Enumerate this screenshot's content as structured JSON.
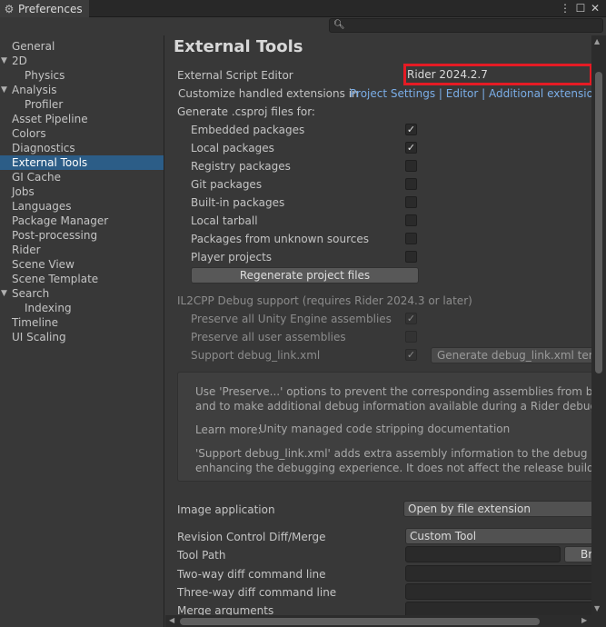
{
  "window": {
    "tab_title": "Preferences",
    "menu_icon": "kebab-menu-icon",
    "maximize_icon": "maximize-icon",
    "close_icon": "close-icon"
  },
  "sidebar": {
    "items": [
      {
        "label": "General"
      },
      {
        "label": "2D",
        "expanded": true
      },
      {
        "label": "Physics"
      },
      {
        "label": "Analysis",
        "expanded": true
      },
      {
        "label": "Profiler"
      },
      {
        "label": "Asset Pipeline"
      },
      {
        "label": "Colors"
      },
      {
        "label": "Diagnostics"
      },
      {
        "label": "External Tools",
        "selected": true
      },
      {
        "label": "GI Cache"
      },
      {
        "label": "Jobs"
      },
      {
        "label": "Languages"
      },
      {
        "label": "Package Manager"
      },
      {
        "label": "Post-processing"
      },
      {
        "label": "Rider"
      },
      {
        "label": "Scene View"
      },
      {
        "label": "Scene Template"
      },
      {
        "label": "Search",
        "expanded": true
      },
      {
        "label": "Indexing"
      },
      {
        "label": "Timeline"
      },
      {
        "label": "UI Scaling"
      }
    ]
  },
  "main": {
    "title": "External Tools",
    "script_editor_label": "External Script Editor",
    "script_editor_value": "Rider 2024.2.7",
    "customize_label": "Customize handled extensions in",
    "customize_links": [
      "Project Settings",
      "Editor",
      "Additional extensions t"
    ],
    "link_separator": "|",
    "csproj_label": "Generate .csproj files for:",
    "csproj_options": [
      {
        "label": "Embedded packages",
        "checked": true
      },
      {
        "label": "Local packages",
        "checked": true
      },
      {
        "label": "Registry packages",
        "checked": false
      },
      {
        "label": "Git packages",
        "checked": false
      },
      {
        "label": "Built-in packages",
        "checked": false
      },
      {
        "label": "Local tarball",
        "checked": false
      },
      {
        "label": "Packages from unknown sources",
        "checked": false
      },
      {
        "label": "Player projects",
        "checked": false
      }
    ],
    "regenerate_button": "Regenerate project files",
    "il2cpp_label": "IL2CPP Debug support (requires Rider 2024.3 or later)",
    "il2cpp_options": [
      {
        "label": "Preserve all Unity Engine assemblies",
        "checked": true
      },
      {
        "label": "Preserve all user assemblies",
        "checked": false
      },
      {
        "label": "Support debug_link.xml",
        "checked": true
      }
    ],
    "generate_link_button": "Generate debug_link.xml templ",
    "help": {
      "line1": "Use 'Preserve...' options to prevent the corresponding assemblies from being re",
      "line2": "and to make additional debug information available during a Rider debug sessi",
      "learn_more_label": "Learn more:",
      "learn_more_link": "Unity managed code stripping documentation",
      "line3": "'Support debug_link.xml' adds extra assembly information to the debug build,",
      "line4": "enhancing the debugging experience. It does not affect the release build outpu"
    },
    "image_app_label": "Image application",
    "image_app_value": "Open by file extension",
    "revision_label": "Revision Control Diff/Merge",
    "revision_value": "Custom Tool",
    "tool_path_label": "Tool Path",
    "browse_button": "Br",
    "two_way_label": "Two-way diff command line",
    "three_way_label": "Three-way diff command line",
    "merge_label": "Merge arguments"
  },
  "colors": {
    "selection": "#2c5d87",
    "link": "#7baee8",
    "highlight": "#e51b24"
  }
}
